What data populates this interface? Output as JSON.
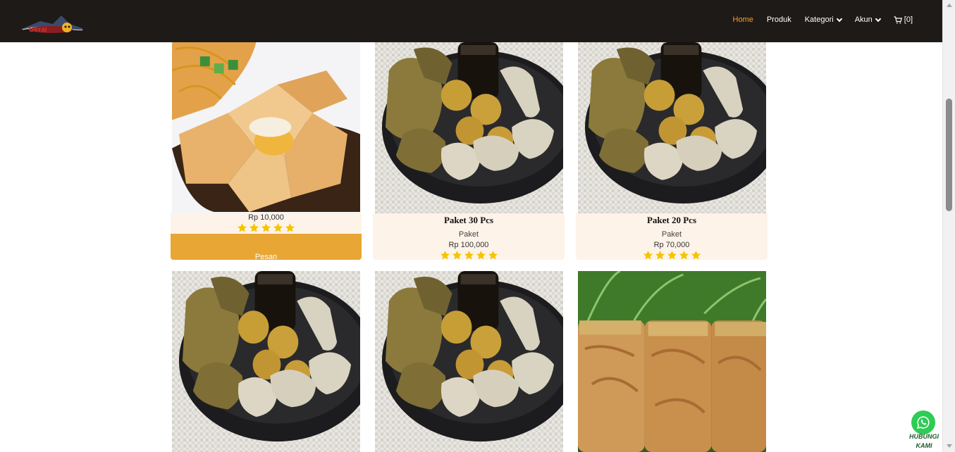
{
  "nav": {
    "brand": "Bakso Ikan Gerai",
    "items": [
      "Home",
      "Produk",
      "Kategori",
      "Akun"
    ],
    "cart": "[0]"
  },
  "colors": {
    "navbar": "#1e1a18",
    "accent": "#f3a31a",
    "card_body": "#fdf3e9",
    "button": "#e8a634",
    "star": "#f5c400",
    "whatsapp": "#2ecc55"
  },
  "products": [
    {
      "name": "",
      "category": "",
      "price": "Rp 10,000",
      "rating": 5,
      "button": "Pesan",
      "image": "fried-tofu-egg"
    },
    {
      "name": "Paket 30 Pcs",
      "category": "Paket",
      "price": "Rp 100,000",
      "rating": 5,
      "image": "pempek-plate"
    },
    {
      "name": "Paket 20 Pcs",
      "category": "Paket",
      "price": "Rp 70,000",
      "rating": 5,
      "image": "pempek-plate"
    },
    {
      "image": "pempek-plate"
    },
    {
      "image": "pempek-plate"
    },
    {
      "image": "fried-shallots-jars"
    }
  ],
  "whatsapp": {
    "label": "HUBUNGI KAMI",
    "icon": "whatsapp-icon"
  }
}
